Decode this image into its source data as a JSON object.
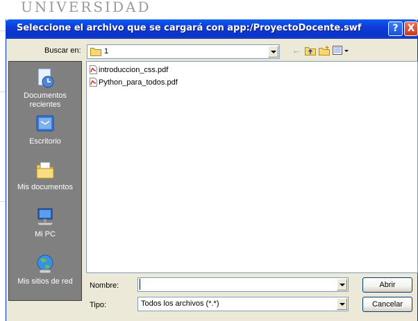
{
  "window": {
    "title": "Seleccione el archivo que se cargará con app:/ProyectoDocente.swf",
    "help_glyph": "?",
    "close_glyph": "X",
    "background_text": "UNIVERSIDAD"
  },
  "toolbar": {
    "look_in_label": "Buscar en:",
    "look_in_value": "1",
    "back_glyph": "←",
    "up_glyph": "⇧",
    "new_folder_glyph": "✱",
    "views_glyph": "▦"
  },
  "places": [
    {
      "label": "Documentos recientes",
      "icon": "recent-documents-icon"
    },
    {
      "label": "Escritorio",
      "icon": "desktop-icon"
    },
    {
      "label": "Mis documentos",
      "icon": "my-documents-icon"
    },
    {
      "label": "Mi PC",
      "icon": "my-computer-icon"
    },
    {
      "label": "Mis sitios de red",
      "icon": "network-places-icon"
    }
  ],
  "files": [
    {
      "name": "introduccion_css.pdf",
      "icon": "pdf-icon"
    },
    {
      "name": "Python_para_todos.pdf",
      "icon": "pdf-icon"
    }
  ],
  "form": {
    "filename_label": "Nombre:",
    "filename_value": "",
    "filetype_label": "Tipo:",
    "filetype_value": "Todos los archivos (*.*)"
  },
  "buttons": {
    "open": "Abrir",
    "cancel": "Cancelar"
  },
  "colors": {
    "titlebar": "#0a35c8",
    "dialog_bg": "#ece9d8",
    "places_bg": "#808080"
  }
}
